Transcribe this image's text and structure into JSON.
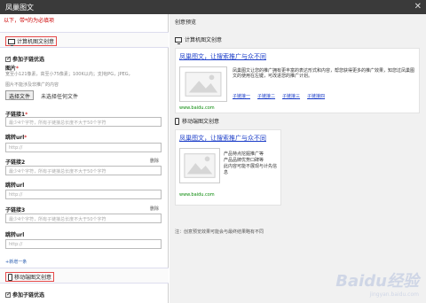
{
  "window": {
    "title": "凤巢图文",
    "close": "✕"
  },
  "left": {
    "required_note": "以下，带*的为必填项",
    "pc_section": "计算机图文创意",
    "pc_optimize": "参加子链优选",
    "image_label": "图片",
    "image_hint1": "宽至小121像素，高至小75像素；100K以内；支持JPG，JPEG，",
    "image_hint2": "图片不能涉及非推广的内容",
    "file_button": "选择文件",
    "file_status": "未选择任何文件",
    "sublink1_label": "子链接1",
    "sublink1_placeholder": "最少4个字符，所有子链接总长度不大于50个字符",
    "url1_label": "跳转url",
    "url_placeholder": "http://",
    "sublink2_label": "子链接2",
    "sublink2_placeholder": "最少4个字符，所有子链接总长度不大于50个字符",
    "url2_label": "跳转url",
    "sublink3_label": "子链接3",
    "sublink3_placeholder": "最少4个字符，所有子链接总长度不大于50个字符",
    "url3_label": "跳转url",
    "delete_label": "删除",
    "add_more": "+新增一条",
    "mobile_section": "移动端图文创意",
    "mobile_optimize": "参加子链优选"
  },
  "right": {
    "preview_title": "创意预览",
    "pc_preview": "计算机图文创意",
    "ad_title": "凤巢图文，让搜索推广与众不同",
    "ad_desc": "凤巢图文让您的推广拥有更丰富的表达形式和内容，帮您获得更多的推广效果，知您过凤巢图文的使用在左键，可改进您的推广计划。",
    "sublinks": [
      "子链接一",
      "子链接二",
      "子链接三",
      "子链接四"
    ],
    "url": "www.baidu.com",
    "mobile_preview": "移动端图文创意",
    "mobile_ad_title": "凤巢图文，让搜索推广与众不同",
    "mobile_lines": [
      "产品特点挖掘推广等",
      "产品品牌优势口碑等",
      "此内容可能不展现与计先信息"
    ],
    "mobile_url": "www.baidu.com",
    "note": "注：创意预览效果可能会与最终结果略有不同"
  },
  "watermark": {
    "text": "Baidu经验",
    "sub": "jingyan.baidu.com"
  }
}
